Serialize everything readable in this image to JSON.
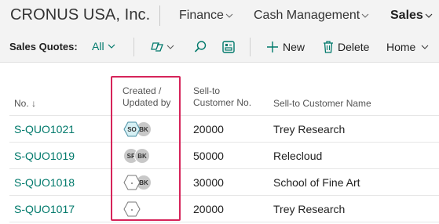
{
  "app": {
    "company": "CRONUS USA, Inc.",
    "nav": [
      {
        "label": "Finance"
      },
      {
        "label": "Cash Management"
      },
      {
        "label": "Sales"
      }
    ]
  },
  "actionbar": {
    "title": "Sales Quotes:",
    "filter": "All",
    "new_label": "New",
    "delete_label": "Delete",
    "home_label": "Home"
  },
  "table": {
    "headers": {
      "no": "No. ↓",
      "created_line1": "Created /",
      "created_line2": "Updated by",
      "sellto_no_line1": "Sell-to",
      "sellto_no_line2": "Customer No.",
      "sellto_name": "Sell-to Customer Name"
    },
    "rows": [
      {
        "no": "S-QUO1021",
        "created": "SO",
        "updated": "BK",
        "created_shape": "hexagon",
        "customer_no": "20000",
        "customer_name": "Trey Research"
      },
      {
        "no": "S-QUO1019",
        "created": "SP",
        "updated": "BK",
        "created_shape": "circle",
        "customer_no": "50000",
        "customer_name": "Relecloud"
      },
      {
        "no": "S-QUO1018",
        "created": "-",
        "updated": "BK",
        "created_shape": "hexagon",
        "customer_no": "30000",
        "customer_name": "School of Fine Art"
      },
      {
        "no": "S-QUO1017",
        "created": "-",
        "updated": "",
        "created_shape": "hexagon",
        "customer_no": "20000",
        "customer_name": "Trey Research"
      }
    ]
  },
  "colors": {
    "accent": "#00796b",
    "highlight": "#d6245a",
    "hexagon_fill": "#d6f0f4",
    "avatar_fill": "#c8c8c8"
  }
}
